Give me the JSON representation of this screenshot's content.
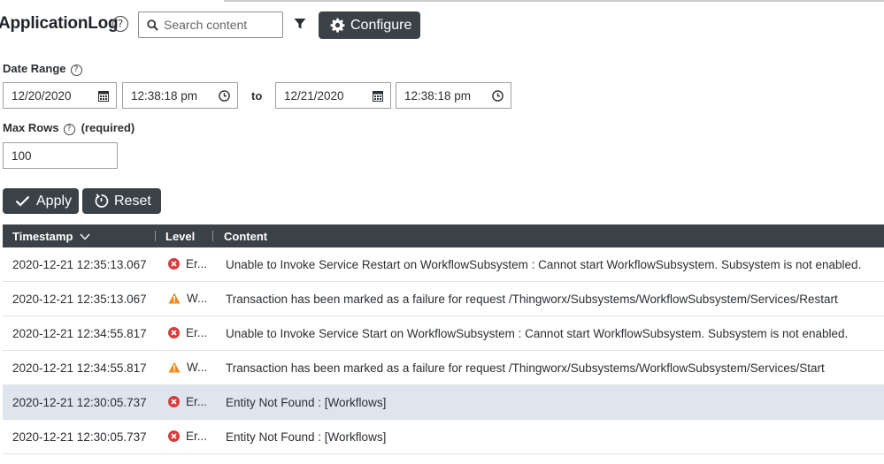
{
  "header": {
    "title": "ApplicationLog",
    "help_glyph": "?",
    "search_placeholder": "Search content",
    "configure_label": "Configure"
  },
  "date_range": {
    "label": "Date Range",
    "start_date": "12/20/2020",
    "start_time": "12:38:18 pm",
    "to_label": "to",
    "end_date": "12/21/2020",
    "end_time": "12:38:18 pm"
  },
  "max_rows": {
    "label": "Max Rows",
    "required": "(required)",
    "value": "100"
  },
  "actions": {
    "apply_label": "Apply",
    "reset_label": "Reset"
  },
  "grid": {
    "columns": [
      "Timestamp",
      "Level",
      "Content"
    ],
    "rows": [
      {
        "timestamp": "2020-12-21 12:35:13.067",
        "level": "error",
        "level_text": "Er...",
        "content": "Unable to Invoke Service Restart on WorkflowSubsystem : Cannot start WorkflowSubsystem. Subsystem is not enabled."
      },
      {
        "timestamp": "2020-12-21 12:35:13.067",
        "level": "warning",
        "level_text": "W...",
        "content": "Transaction has been marked as a failure for request /Thingworx/Subsystems/WorkflowSubsystem/Services/Restart"
      },
      {
        "timestamp": "2020-12-21 12:34:55.817",
        "level": "error",
        "level_text": "Er...",
        "content": "Unable to Invoke Service Start on WorkflowSubsystem : Cannot start WorkflowSubsystem. Subsystem is not enabled."
      },
      {
        "timestamp": "2020-12-21 12:34:55.817",
        "level": "warning",
        "level_text": "W...",
        "content": "Transaction has been marked as a failure for request /Thingworx/Subsystems/WorkflowSubsystem/Services/Start"
      },
      {
        "timestamp": "2020-12-21 12:30:05.737",
        "level": "error",
        "level_text": "Er...",
        "content": "Entity Not Found : [Workflows]",
        "selected": true
      },
      {
        "timestamp": "2020-12-21 12:30:05.737",
        "level": "error",
        "level_text": "Er...",
        "content": "Entity Not Found : [Workflows]"
      }
    ]
  },
  "colors": {
    "dark": "#3a4147",
    "error": "#d93a3a",
    "warning": "#ef8a1e",
    "selected_row": "#dee5ee"
  }
}
